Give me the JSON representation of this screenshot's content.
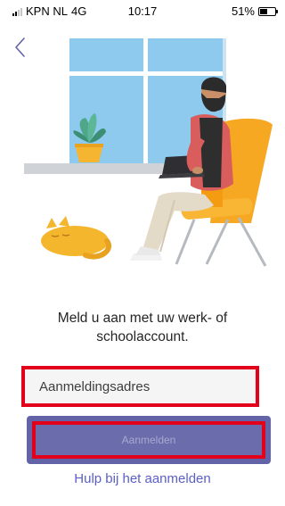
{
  "status_bar": {
    "carrier": "KPN NL",
    "network": "4G",
    "time": "10:17",
    "battery_percent": "51%",
    "battery_level": 0.51
  },
  "nav": {
    "back_icon": "chevron-left-icon"
  },
  "illustration": {
    "name": "person-at-window-with-laptop-and-cat"
  },
  "signin": {
    "prompt": "Meld u aan met uw werk- of schoolaccount.",
    "address_placeholder": "Aanmeldingsadres",
    "address_value": "",
    "submit_label": "Aanmelden",
    "help_link": "Hulp bij het aanmelden"
  },
  "colors": {
    "brand": "#6264a7",
    "highlight": "#e2001a",
    "link": "#5b5fc7"
  }
}
